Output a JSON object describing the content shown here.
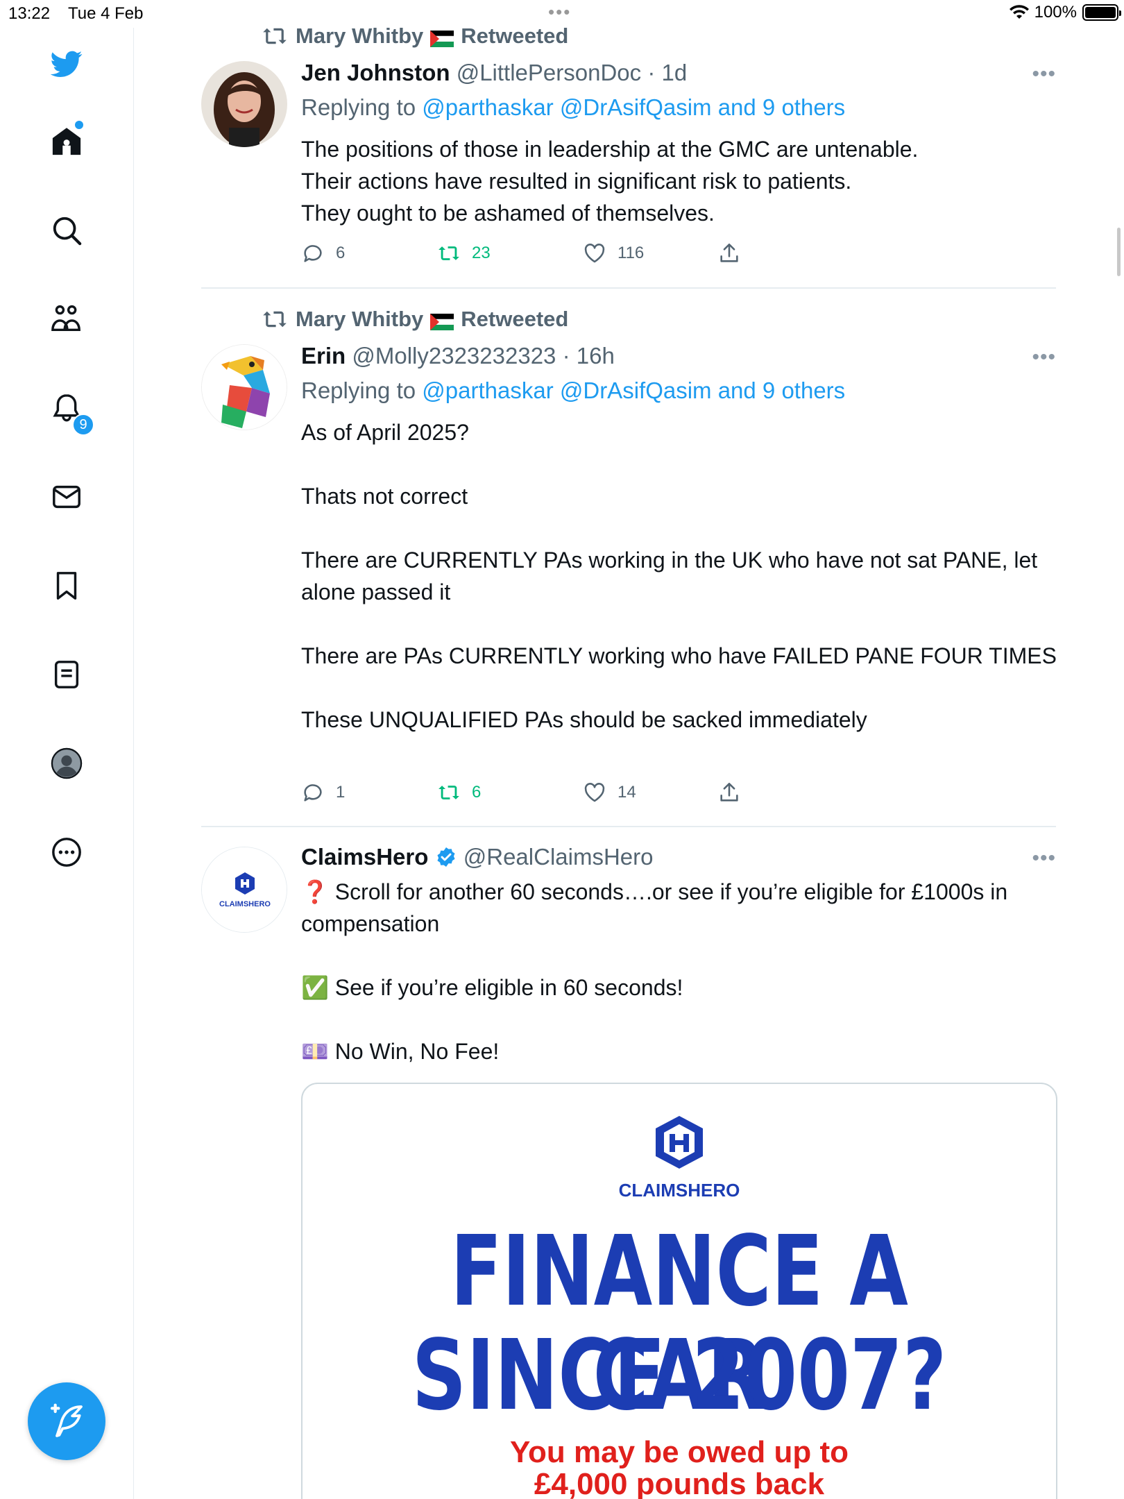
{
  "status_bar": {
    "time": "13:22",
    "date": "Tue 4 Feb",
    "battery": "100%"
  },
  "sidebar": {
    "notifications_count": "9",
    "icons": [
      "twitter-logo-icon",
      "home-icon",
      "search-icon",
      "communities-icon",
      "notifications-icon",
      "messages-icon",
      "bookmarks-icon",
      "lists-icon",
      "profile-icon",
      "more-icon",
      "compose-icon"
    ]
  },
  "tweets": [
    {
      "retweeted_by": "Mary Whitby",
      "retweet_label": "Retweeted",
      "name": "Jen Johnston",
      "handle": "@LittlePersonDoc",
      "time": "· 1d",
      "reply_prefix": "Replying to",
      "reply_to": "@parthaskar @DrAsifQasim and 9 others",
      "text": "The positions of those in leadership at the GMC are untenable.\nTheir actions have resulted in significant risk to patients.\nThey ought to be ashamed of themselves.",
      "replies": "6",
      "retweets": "23",
      "likes": "116"
    },
    {
      "retweeted_by": "Mary Whitby",
      "retweet_label": "Retweeted",
      "name": "Erin",
      "handle": "@Molly2323232323",
      "time": "· 16h",
      "reply_prefix": "Replying to",
      "reply_to": "@parthaskar @DrAsifQasim and 9 others",
      "text": "As of April 2025?\n\nThats not correct\n\nThere are CURRENTLY PAs working in the UK who have not sat PANE, let alone passed it\n\nThere are PAs CURRENTLY working who have FAILED PANE FOUR TIMES\n\nThese UNQUALIFIED PAs should be sacked immediately",
      "replies": "1",
      "retweets": "6",
      "likes": "14"
    },
    {
      "name": "ClaimsHero",
      "handle": "@RealClaimsHero",
      "avatar_text": "CLAIMSHERO",
      "text": "❓ Scroll for another 60 seconds….or see if you’re eligible for £1000s in compensation\n\n✅ See if you’re eligible in 60 seconds!\n\n💷 No Win, No Fee!",
      "card": {
        "brand": "CLAIMSHERO",
        "headline_1": "FINANCE A CAR",
        "headline_2": "SINCE 2007?",
        "sub_1": "You may be owed up to",
        "sub_2": "£4,000 pounds back"
      }
    }
  ],
  "colors": {
    "accent": "#1d9bf0",
    "retweet_green": "#00ba7c",
    "brand_blue": "#1c3db3",
    "promo_red": "#e0201c"
  }
}
